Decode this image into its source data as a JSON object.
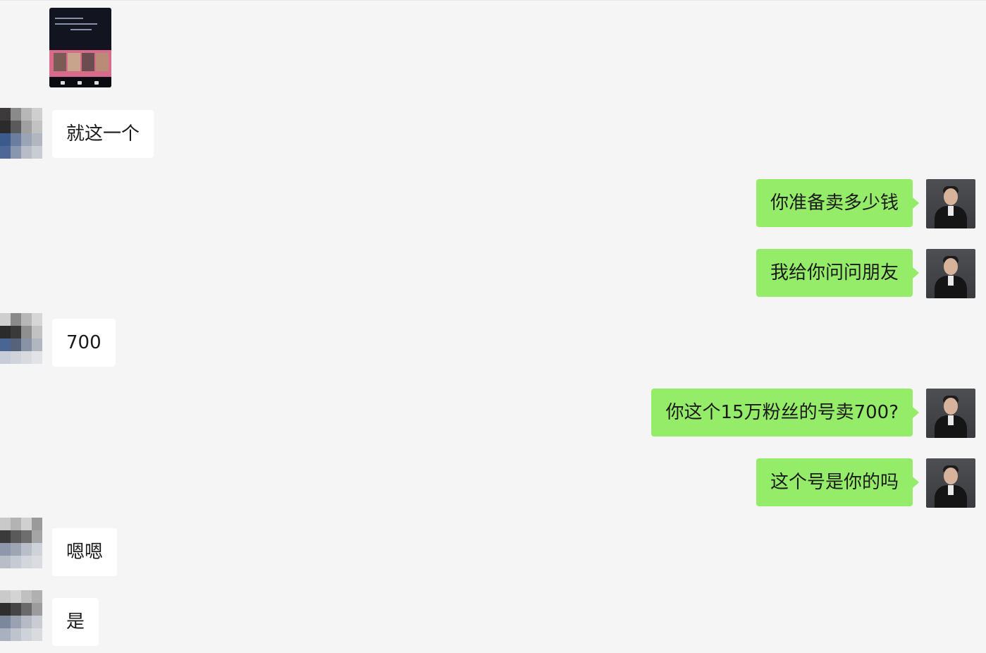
{
  "messages": [
    {
      "side": "in",
      "text": "就这一个"
    },
    {
      "side": "out",
      "text": "你准备卖多少钱"
    },
    {
      "side": "out",
      "text": "我给你问问朋友"
    },
    {
      "side": "in",
      "text": "700"
    },
    {
      "side": "out",
      "text": "你这个15万粉丝的号卖700?"
    },
    {
      "side": "out",
      "text": "这个号是你的吗"
    },
    {
      "side": "in",
      "text": "嗯嗯"
    },
    {
      "side": "in",
      "text": "是"
    }
  ],
  "colors": {
    "background": "#f5f5f5",
    "incoming_bubble": "#ffffff",
    "outgoing_bubble": "#95ec69",
    "text": "#1a1a1a"
  }
}
